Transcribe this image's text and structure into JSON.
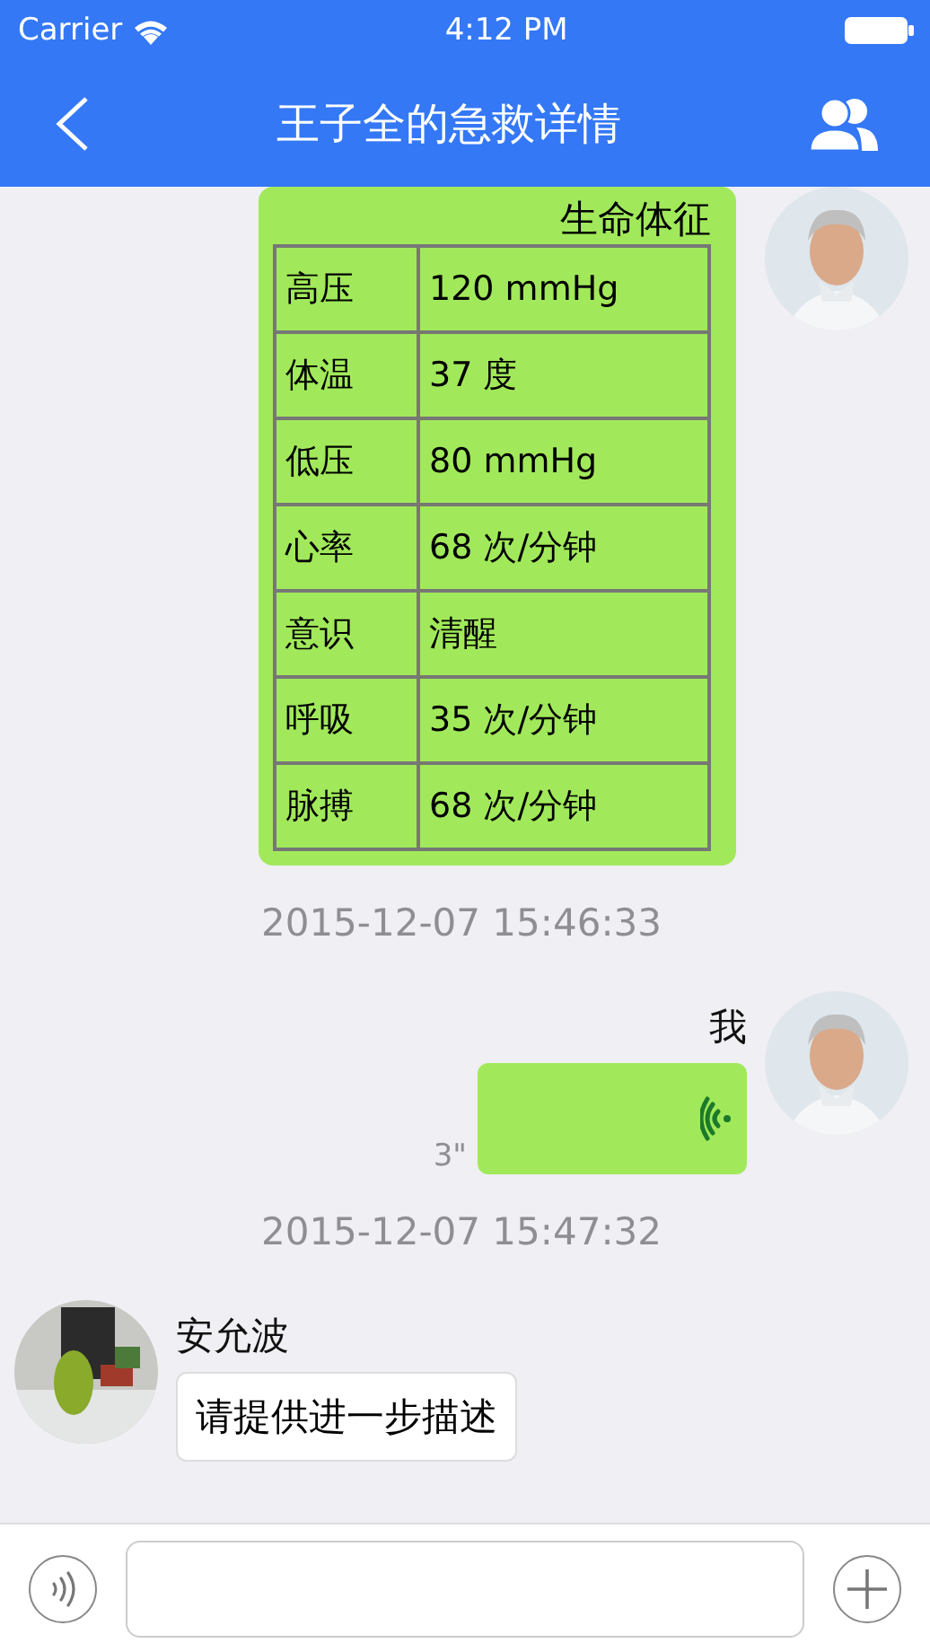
{
  "status_bar": {
    "carrier": "Carrier",
    "time": "4:12 PM"
  },
  "nav": {
    "title": "王子全的急救详情"
  },
  "messages": [
    {
      "kind": "vitals",
      "mine": true,
      "title": "生命体征",
      "rows": [
        {
          "label": "高压",
          "value": "120 mmHg"
        },
        {
          "label": "体温",
          "value": "37 度"
        },
        {
          "label": "低压",
          "value": "80 mmHg"
        },
        {
          "label": "心率",
          "value": "68 次/分钟"
        },
        {
          "label": "意识",
          "value": "清醒"
        },
        {
          "label": "呼吸",
          "value": "35 次/分钟"
        },
        {
          "label": "脉搏",
          "value": "68 次/分钟"
        }
      ]
    },
    {
      "kind": "time",
      "text": "2015-12-07 15:46:33"
    },
    {
      "kind": "voice",
      "mine": true,
      "sender": "我",
      "duration": "3\""
    },
    {
      "kind": "time",
      "text": "2015-12-07 15:47:32"
    },
    {
      "kind": "text",
      "mine": false,
      "sender": "安允波",
      "text": "请提供进一步描述"
    }
  ]
}
